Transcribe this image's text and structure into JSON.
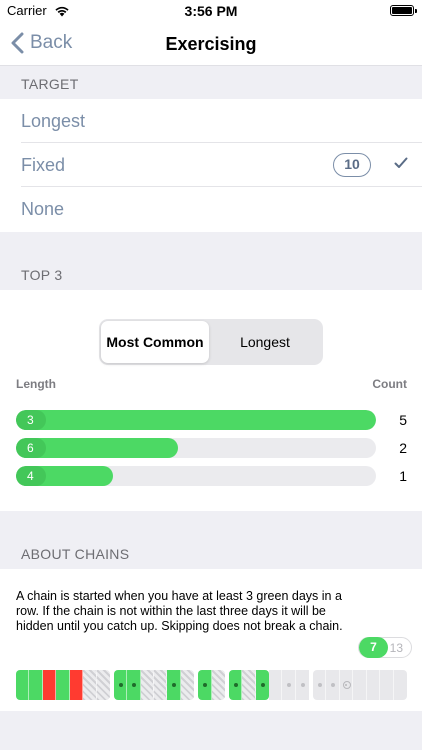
{
  "status_bar": {
    "carrier": "Carrier",
    "time": "3:56 PM"
  },
  "nav": {
    "back_label": "Back",
    "title": "Exercising"
  },
  "target": {
    "header": "TARGET",
    "options": [
      {
        "label": "Longest"
      },
      {
        "label": "Fixed",
        "value": "10",
        "selected": true
      },
      {
        "label": "None"
      }
    ]
  },
  "top3": {
    "header": "TOP 3",
    "segments": [
      "Most Common",
      "Longest"
    ],
    "selected_segment": "Most Common",
    "length_header": "Length",
    "count_header": "Count",
    "bars": [
      {
        "length": "3",
        "count": "5",
        "fraction": 1.0
      },
      {
        "length": "6",
        "count": "2",
        "fraction": 0.45
      },
      {
        "length": "4",
        "count": "1",
        "fraction": 0.27
      }
    ]
  },
  "about": {
    "header": "ABOUT CHAINS",
    "text": "A chain is started when you have at least 3 green days in a row. If the chain is not within the last three days it will be hidden until you catch up. Skipping does not break a chain.",
    "toggle_on": "7",
    "toggle_off": "13"
  },
  "colors": {
    "accent": "#7b8ea8",
    "green": "#4cd964",
    "red": "#ff3b30",
    "background": "#efeff4"
  }
}
